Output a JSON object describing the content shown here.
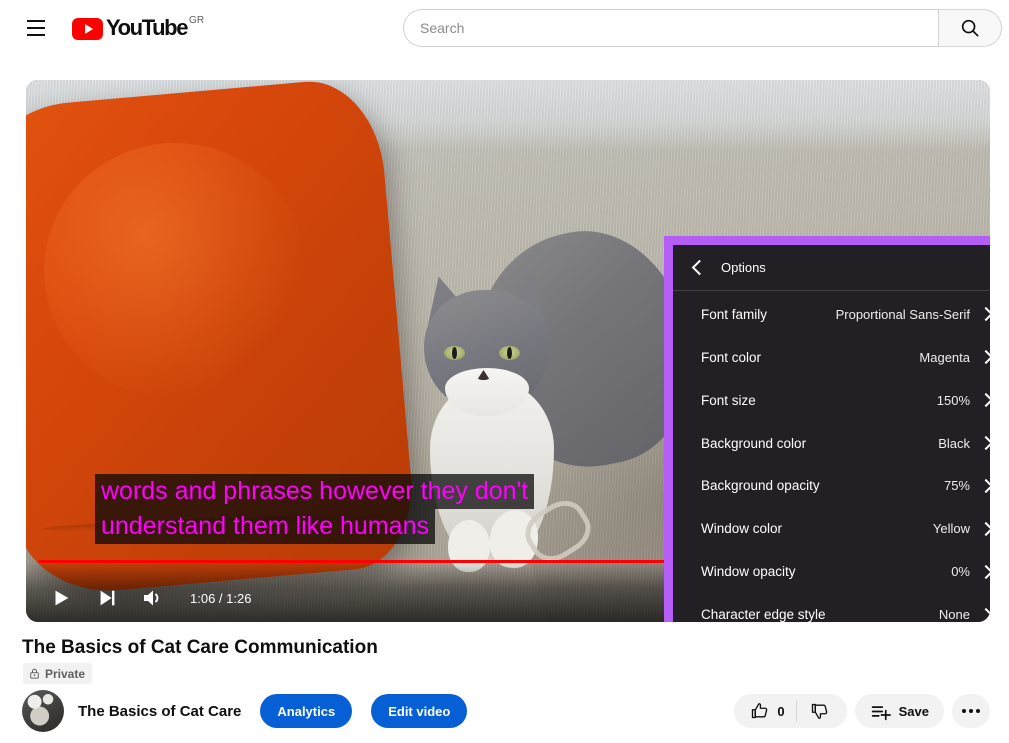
{
  "header": {
    "menu_icon": "hamburger-icon",
    "logo_text": "YouTube",
    "logo_country": "GR",
    "search": {
      "value": "",
      "placeholder": "Search",
      "button_icon": "search-icon"
    }
  },
  "player": {
    "captions": {
      "line1": "words and phrases however they don't",
      "line2": "understand them like humans",
      "font_color": "#ff00ff",
      "background_color": "rgba(10,10,10,0.75)"
    },
    "progress": {
      "percent": 77,
      "played_color": "#ff0000",
      "buffer_color": "rgba(255,255,255,0.55)"
    },
    "controls": {
      "play_icon": "play-icon",
      "next_icon": "next-track-icon",
      "volume_icon": "volume-icon",
      "time": "1:06 / 1:26",
      "current_time": "1:06",
      "duration": "1:26",
      "subtitles_icon": "closed-captions-icon",
      "settings_icon": "gear-icon",
      "miniplayer_icon": "miniplayer-icon",
      "theater_icon": "theater-mode-icon",
      "fullscreen_icon": "fullscreen-icon",
      "settings_highlight_color": "#b45ef5"
    }
  },
  "settings_menu": {
    "highlight_color": "#b45ef5",
    "back_icon": "back-chevron-icon",
    "title": "Options",
    "rows": [
      {
        "label": "Font family",
        "value": "Proportional Sans-Serif"
      },
      {
        "label": "Font color",
        "value": "Magenta"
      },
      {
        "label": "Font size",
        "value": "150%"
      },
      {
        "label": "Background color",
        "value": "Black"
      },
      {
        "label": "Background opacity",
        "value": "75%"
      },
      {
        "label": "Window color",
        "value": "Yellow"
      },
      {
        "label": "Window opacity",
        "value": "0%"
      },
      {
        "label": "Character edge style",
        "value": "None"
      }
    ]
  },
  "video_info": {
    "title": "The Basics of Cat Care Communication",
    "privacy": "Private",
    "privacy_icon": "lock-icon",
    "channel_name": "The Basics of Cat Care",
    "analytics_label": "Analytics",
    "edit_video_label": "Edit video",
    "accent_color": "#065fd4"
  },
  "actions": {
    "like_icon": "thumbs-up-icon",
    "like_count": "0",
    "dislike_icon": "thumbs-down-icon",
    "save_icon": "save-to-playlist-icon",
    "save_label": "Save",
    "more_icon": "more-options-icon"
  }
}
